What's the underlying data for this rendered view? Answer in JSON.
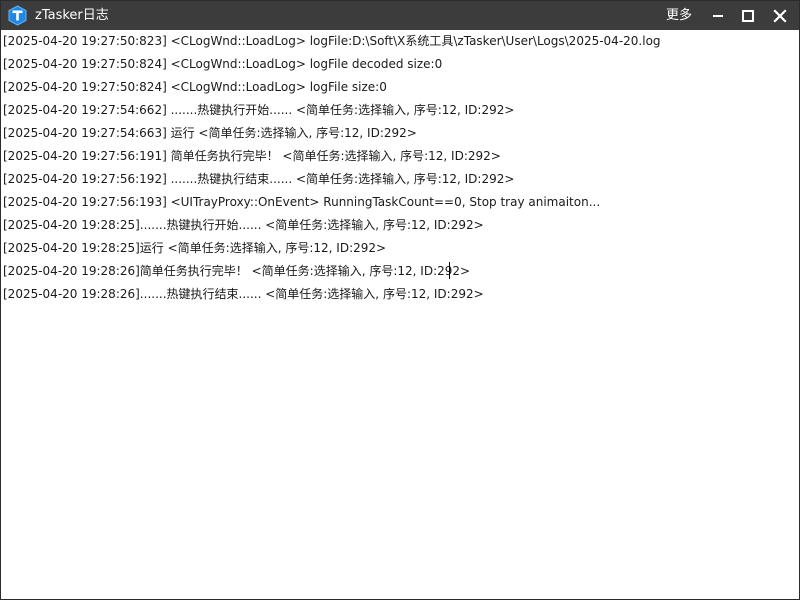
{
  "window": {
    "title": "zTasker日志",
    "more_label": "更多"
  },
  "colors": {
    "titlebar": "#3c3c3c",
    "logo_blue": "#1e88e5",
    "log_bg": "#ffffff",
    "log_text": "#1a1a1a"
  },
  "log": {
    "lines": [
      "[2025-04-20 19:27:50:823] <CLogWnd::LoadLog> logFile:D:\\Soft\\X系统工具\\zTasker\\User\\Logs\\2025-04-20.log",
      "[2025-04-20 19:27:50:824] <CLogWnd::LoadLog> logFile decoded size:0",
      "[2025-04-20 19:27:50:824] <CLogWnd::LoadLog> logFile size:0",
      "[2025-04-20 19:27:54:662] .......热键执行开始...... <简单任务:选择输入, 序号:12, ID:292>",
      "[2025-04-20 19:27:54:663] 运行 <简单任务:选择输入, 序号:12, ID:292>",
      "[2025-04-20 19:27:56:191] 简单任务执行完毕！ <简单任务:选择输入, 序号:12, ID:292>",
      "[2025-04-20 19:27:56:192] .......热键执行结束...... <简单任务:选择输入, 序号:12, ID:292>",
      "[2025-04-20 19:27:56:193] <UITrayProxy::OnEvent> RunningTaskCount==0,   Stop tray animaiton...",
      "[2025-04-20 19:28:25].......热键执行开始...... <简单任务:选择输入, 序号:12, ID:292>",
      "[2025-04-20 19:28:25]运行 <简单任务:选择输入, 序号:12, ID:292>",
      "[2025-04-20 19:28:26]简单任务执行完毕！ <简单任务:选择输入, 序号:12, ID:292>",
      "[2025-04-20 19:28:26].......热键执行结束...... <简单任务:选择输入, 序号:12, ID:292>"
    ]
  }
}
